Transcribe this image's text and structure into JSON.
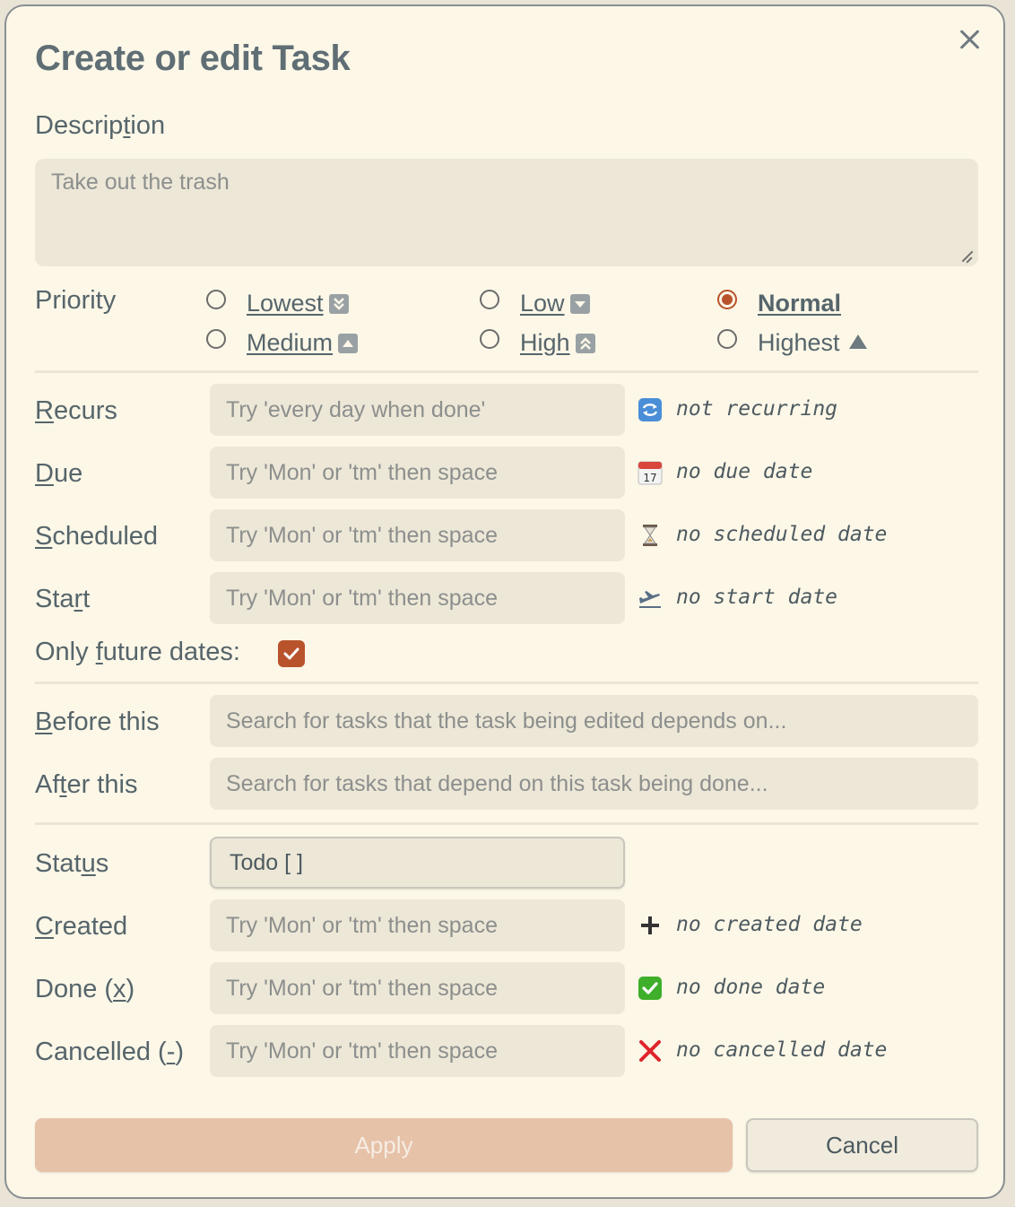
{
  "dialog": {
    "title": "Create or edit Task",
    "close_icon": "close-icon"
  },
  "description": {
    "label": "Description",
    "placeholder": "Take out the trash"
  },
  "priority": {
    "label": "Priority",
    "options": [
      {
        "label": "Lowest",
        "icon": "double-chevron-down-icon",
        "selected": false
      },
      {
        "label": "Low",
        "icon": "chevron-down-icon",
        "selected": false
      },
      {
        "label": "Normal",
        "icon": "",
        "selected": true
      },
      {
        "label": "Medium",
        "icon": "chevron-up-icon",
        "selected": false
      },
      {
        "label": "High",
        "icon": "double-chevron-up-icon",
        "selected": false
      },
      {
        "label": "Highest",
        "icon": "triangle-up-icon",
        "selected": false
      }
    ],
    "accent": "#b8532c"
  },
  "dates": {
    "recurs": {
      "label": "Recurs",
      "placeholder": "Try 'every day when done'",
      "hint": "not recurring",
      "icon": "recurring-icon"
    },
    "due": {
      "label": "Due",
      "placeholder": "Try 'Mon' or 'tm' then space",
      "hint": "no due date",
      "icon": "calendar-icon",
      "icon_text": "17"
    },
    "scheduled": {
      "label": "Scheduled",
      "placeholder": "Try 'Mon' or 'tm' then space",
      "hint": "no scheduled date",
      "icon": "hourglass-icon"
    },
    "start": {
      "label": "Start",
      "placeholder": "Try 'Mon' or 'tm' then space",
      "hint": "no start date",
      "icon": "airplane-departure-icon"
    },
    "only_future": {
      "label": "Only future dates:",
      "checked": true
    }
  },
  "dependencies": {
    "before": {
      "label": "Before this",
      "placeholder": "Search for tasks that the task being edited depends on..."
    },
    "after": {
      "label": "After this",
      "placeholder": "Search for tasks that depend on this task being done..."
    }
  },
  "status": {
    "label": "Status",
    "value": "Todo [ ]",
    "created": {
      "label": "Created",
      "placeholder": "Try 'Mon' or 'tm' then space",
      "hint": "no created date",
      "icon": "plus-icon"
    },
    "done": {
      "label": "Done (x)",
      "placeholder": "Try 'Mon' or 'tm' then space",
      "hint": "no done date",
      "icon": "check-mark-button-icon"
    },
    "cancelled": {
      "label": "Cancelled (-)",
      "placeholder": "Try 'Mon' or 'tm' then space",
      "hint": "no cancelled date",
      "icon": "cross-mark-icon"
    }
  },
  "buttons": {
    "apply": "Apply",
    "cancel": "Cancel"
  }
}
